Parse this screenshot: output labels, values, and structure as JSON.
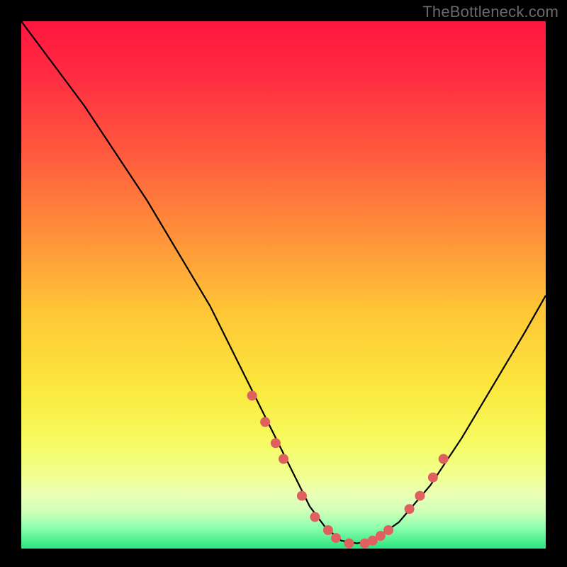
{
  "watermark": "TheBottleneck.com",
  "chart_data": {
    "type": "line",
    "title": "",
    "xlabel": "",
    "ylabel": "",
    "xlim": [
      0,
      100
    ],
    "ylim": [
      0,
      100
    ],
    "series": [
      {
        "name": "curve",
        "x": [
          0,
          6,
          12,
          18,
          24,
          30,
          36,
          40,
          44,
          48,
          52,
          55,
          58,
          61,
          64,
          67,
          72,
          78,
          84,
          90,
          96,
          100
        ],
        "y": [
          100,
          92,
          84,
          75,
          66,
          56,
          46,
          38,
          30,
          22,
          14,
          8,
          4,
          1.5,
          1,
          1.5,
          5,
          12,
          21,
          31,
          41,
          48
        ]
      }
    ],
    "markers": {
      "name": "dots",
      "color": "#e06060",
      "x": [
        44,
        46.5,
        48.5,
        50,
        53.5,
        56,
        58.5,
        60,
        62.5,
        65.5,
        67,
        68.5,
        70,
        74,
        76,
        78.5,
        80.5
      ],
      "y": [
        29,
        24,
        20,
        17,
        10,
        6,
        3.5,
        2,
        1,
        1,
        1.5,
        2.4,
        3.5,
        7.5,
        10,
        13.5,
        17
      ]
    }
  },
  "colors": {
    "curve": "#000000",
    "marker": "#de6565",
    "background_top": "#ff163f",
    "background_bottom": "#29e57e"
  }
}
